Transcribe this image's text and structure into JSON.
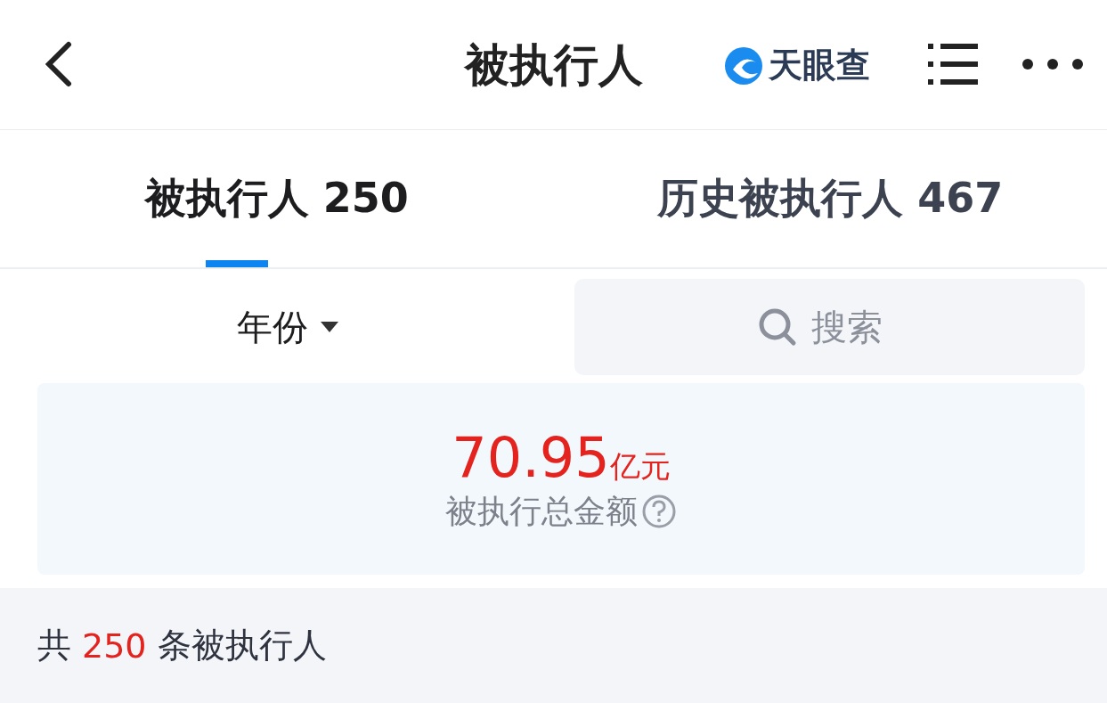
{
  "header": {
    "title": "被执行人",
    "logo_text": "天眼查"
  },
  "tabs": [
    {
      "label": "被执行人",
      "count": "250",
      "selected": true
    },
    {
      "label": "历史被执行人",
      "count": "467",
      "selected": false
    }
  ],
  "filter": {
    "year_label": "年份",
    "search": {
      "placeholder": "搜索"
    }
  },
  "summary": {
    "amount": "70.95",
    "unit": "亿元",
    "caption": "被执行总金额"
  },
  "total": {
    "prefix": "共",
    "count": "250",
    "suffix": "条被执行人"
  }
}
